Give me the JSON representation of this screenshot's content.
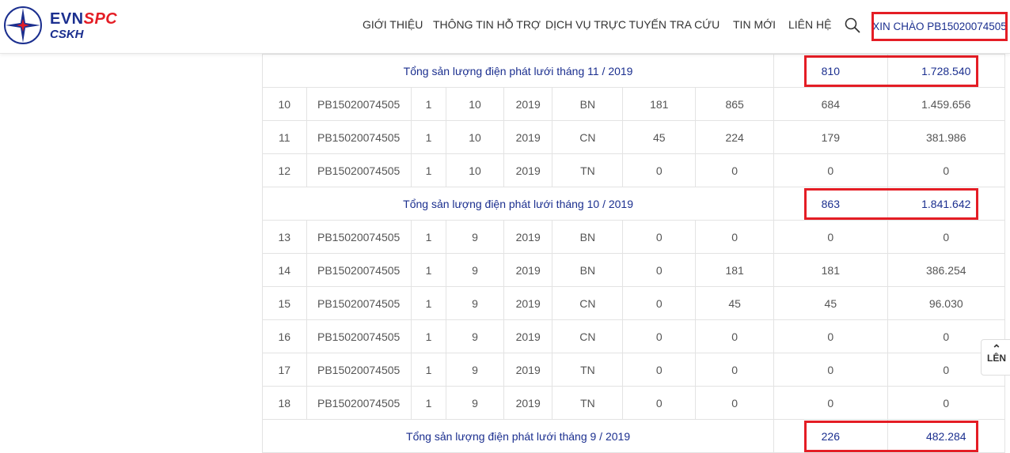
{
  "header": {
    "logo": {
      "brand_evn": "EVN",
      "brand_spc": "SPC",
      "sub": "CSKH"
    },
    "nav": [
      {
        "label": "GIỚI THIỆU"
      },
      {
        "label": "THÔNG TIN HỖ TRỢ"
      },
      {
        "label": "DỊCH VỤ TRỰC TUYẾN"
      },
      {
        "label": "TRA CỨU"
      },
      {
        "label": "TIN MỚI"
      },
      {
        "label": "LIÊN HỆ"
      }
    ],
    "search_icon": "search-icon",
    "greeting": "XIN CHÀO PB15020074505"
  },
  "table": {
    "rows": [
      {
        "type": "summary",
        "label": "Tổng sản lượng điện phát lưới tháng 11 / 2019",
        "total_kwh": "810",
        "total_money": "1.728.540"
      },
      {
        "type": "data",
        "cells": [
          "10",
          "PB15020074505",
          "1",
          "10",
          "2019",
          "BN",
          "181",
          "865",
          "684",
          "1.459.656"
        ]
      },
      {
        "type": "data",
        "cells": [
          "11",
          "PB15020074505",
          "1",
          "10",
          "2019",
          "CN",
          "45",
          "224",
          "179",
          "381.986"
        ]
      },
      {
        "type": "data",
        "cells": [
          "12",
          "PB15020074505",
          "1",
          "10",
          "2019",
          "TN",
          "0",
          "0",
          "0",
          "0"
        ]
      },
      {
        "type": "summary",
        "label": "Tổng sản lượng điện phát lưới tháng 10 / 2019",
        "total_kwh": "863",
        "total_money": "1.841.642"
      },
      {
        "type": "data",
        "cells": [
          "13",
          "PB15020074505",
          "1",
          "9",
          "2019",
          "BN",
          "0",
          "0",
          "0",
          "0"
        ]
      },
      {
        "type": "data",
        "cells": [
          "14",
          "PB15020074505",
          "1",
          "9",
          "2019",
          "BN",
          "0",
          "181",
          "181",
          "386.254"
        ]
      },
      {
        "type": "data",
        "cells": [
          "15",
          "PB15020074505",
          "1",
          "9",
          "2019",
          "CN",
          "0",
          "45",
          "45",
          "96.030"
        ]
      },
      {
        "type": "data",
        "cells": [
          "16",
          "PB15020074505",
          "1",
          "9",
          "2019",
          "CN",
          "0",
          "0",
          "0",
          "0"
        ]
      },
      {
        "type": "data",
        "cells": [
          "17",
          "PB15020074505",
          "1",
          "9",
          "2019",
          "TN",
          "0",
          "0",
          "0",
          "0"
        ]
      },
      {
        "type": "data",
        "cells": [
          "18",
          "PB15020074505",
          "1",
          "9",
          "2019",
          "TN",
          "0",
          "0",
          "0",
          "0"
        ]
      },
      {
        "type": "summary",
        "label": "Tổng sản lượng điện phát lưới tháng 9 / 2019",
        "total_kwh": "226",
        "total_money": "482.284"
      }
    ]
  },
  "back_to_top": {
    "label": "LÊN"
  },
  "colors": {
    "brand_blue": "#1b2f8f",
    "brand_red": "#e41d25",
    "highlight": "#e41d25"
  }
}
